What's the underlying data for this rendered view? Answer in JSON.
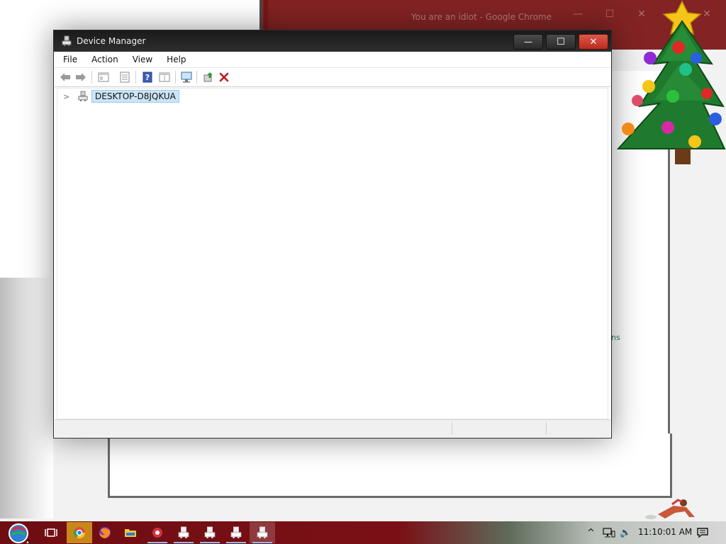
{
  "background": {
    "chrome_title": "You are an idiot - Google Chrome",
    "right_link_text": "ns"
  },
  "window": {
    "title": "Device Manager",
    "minimize_glyph": "—",
    "maximize_glyph": "☐",
    "close_glyph": "✕"
  },
  "menu": {
    "items": [
      "File",
      "Action",
      "View",
      "Help"
    ]
  },
  "toolbar": {
    "icons": [
      "back-icon",
      "forward-icon",
      "show-hide-console-tree-icon",
      "properties-icon",
      "help-icon",
      "details-view-icon",
      "scan-hardware-icon",
      "update-driver-icon",
      "uninstall-icon"
    ]
  },
  "tree": {
    "root_label": "DESKTOP-D8JQKUA",
    "expander_glyph": ">"
  },
  "taskbar": {
    "icons": [
      "start-orb-icon",
      "task-view-icon",
      "chrome-icon",
      "firefox-icon",
      "file-explorer-icon",
      "app-red-icon",
      "device-manager-icon",
      "device-manager-icon",
      "device-manager-icon",
      "device-manager-icon"
    ],
    "clock": "11:10:01 AM",
    "tray_glyphs": {
      "chevron": "^",
      "volume": "🔈",
      "notifications": "▭"
    }
  },
  "colors": {
    "taskbar_red": "#7a1016",
    "close_red": "#d04434",
    "selection_blue": "#cce4f7"
  }
}
